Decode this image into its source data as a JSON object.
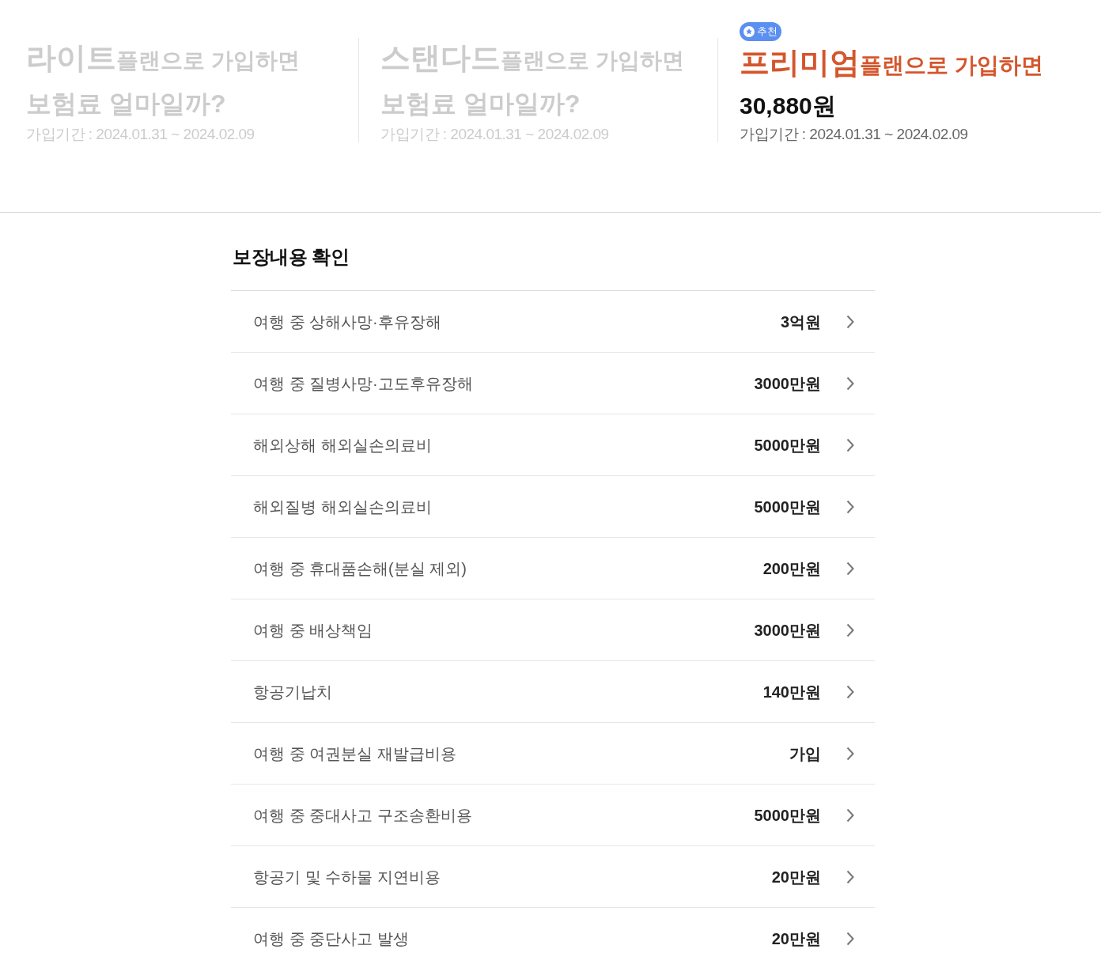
{
  "plans": [
    {
      "name": "라이트",
      "suffix": "플랜으로 가입하면",
      "line2": "보험료 얼마일까?",
      "period": "가입기간 : 2024.01.31 ~ 2024.02.09",
      "selected": false
    },
    {
      "name": "스탠다드",
      "suffix": "플랜으로 가입하면",
      "line2": "보험료 얼마일까?",
      "period": "가입기간 : 2024.01.31 ~ 2024.02.09",
      "selected": false
    },
    {
      "name": "프리미엄",
      "suffix": "플랜으로 가입하면",
      "line2": "30,880원",
      "period": "가입기간 : 2024.01.31 ~ 2024.02.09",
      "selected": true,
      "badge": "추천"
    }
  ],
  "coverage": {
    "title": "보장내용 확인",
    "rows": [
      {
        "label": "여행 중 상해사망·후유장해",
        "amount": "3억원"
      },
      {
        "label": "여행 중 질병사망·고도후유장해",
        "amount": "3000만원"
      },
      {
        "label": "해외상해 해외실손의료비",
        "amount": "5000만원"
      },
      {
        "label": "해외질병 해외실손의료비",
        "amount": "5000만원"
      },
      {
        "label": "여행 중 휴대품손해(분실 제외)",
        "amount": "200만원"
      },
      {
        "label": "여행 중 배상책임",
        "amount": "3000만원"
      },
      {
        "label": "항공기납치",
        "amount": "140만원"
      },
      {
        "label": "여행 중 여권분실 재발급비용",
        "amount": "가입"
      },
      {
        "label": "여행 중 중대사고 구조송환비용",
        "amount": "5000만원"
      },
      {
        "label": "항공기 및 수하물 지연비용",
        "amount": "20만원"
      },
      {
        "label": "여행 중 중단사고 발생",
        "amount": "20만원"
      }
    ]
  }
}
